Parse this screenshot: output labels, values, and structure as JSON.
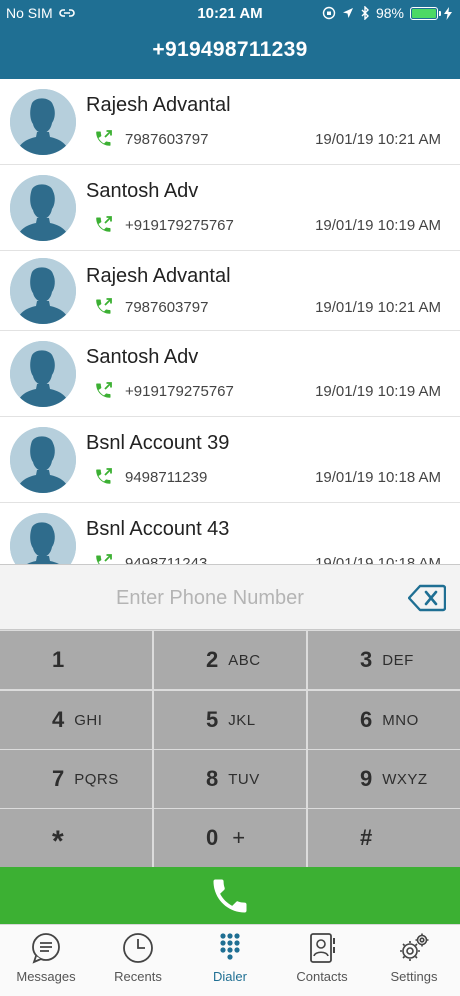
{
  "status_bar": {
    "carrier": "No SIM",
    "time": "10:21 AM",
    "battery": "98%"
  },
  "header": {
    "title": "+919498711239"
  },
  "recents": [
    {
      "name": "Rajesh Advantal",
      "number": "7987603797",
      "datetime": "19/01/19 10:21 AM"
    },
    {
      "name": "Santosh Adv",
      "number": "+919179275767",
      "datetime": "19/01/19 10:19 AM"
    },
    {
      "name": "Rajesh Advantal",
      "number": "7987603797",
      "datetime": "19/01/19 10:21 AM"
    },
    {
      "name": "Santosh Adv",
      "number": "+919179275767",
      "datetime": "19/01/19 10:19 AM"
    },
    {
      "name": "Bsnl Account 39",
      "number": "9498711239",
      "datetime": "19/01/19 10:18 AM"
    },
    {
      "name": "Bsnl Account 43",
      "number": "9498711243",
      "datetime": "19/01/19 10:18 AM"
    }
  ],
  "dialer": {
    "placeholder": "Enter Phone Number",
    "value": "",
    "keys": [
      {
        "digit": "1",
        "letters": ""
      },
      {
        "digit": "2",
        "letters": "ABC"
      },
      {
        "digit": "3",
        "letters": "DEF"
      },
      {
        "digit": "4",
        "letters": "GHI"
      },
      {
        "digit": "5",
        "letters": "JKL"
      },
      {
        "digit": "6",
        "letters": "MNO"
      },
      {
        "digit": "7",
        "letters": "PQRS"
      },
      {
        "digit": "8",
        "letters": "TUV"
      },
      {
        "digit": "9",
        "letters": "WXYZ"
      },
      {
        "digit": "*",
        "letters": ""
      },
      {
        "digit": "0",
        "letters": "+"
      },
      {
        "digit": "#",
        "letters": ""
      }
    ]
  },
  "tabs": [
    {
      "label": "Messages",
      "icon": "messages-icon"
    },
    {
      "label": "Recents",
      "icon": "clock-icon"
    },
    {
      "label": "Dialer",
      "icon": "keypad-icon",
      "active": true
    },
    {
      "label": "Contacts",
      "icon": "contacts-icon"
    },
    {
      "label": "Settings",
      "icon": "gear-icon"
    }
  ],
  "colors": {
    "header": "#1f6f93",
    "call_button": "#3cb033",
    "keypad_key": "#aaaaaa",
    "call_icon_green": "#3cb033",
    "active_tab": "#1f6f93"
  }
}
